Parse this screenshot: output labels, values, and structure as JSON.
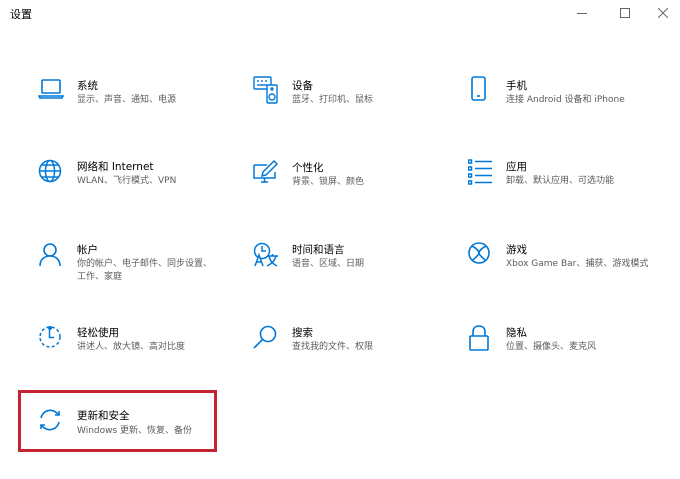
{
  "window": {
    "title": "设置"
  },
  "tiles": [
    {
      "name": "系统",
      "desc": "显示、声音、通知、电源",
      "icon": "laptop-icon"
    },
    {
      "name": "设备",
      "desc": "蓝牙、打印机、鼠标",
      "icon": "keyboard-speaker-icon"
    },
    {
      "name": "手机",
      "desc": "连接 Android 设备和 iPhone",
      "icon": "phone-icon"
    },
    {
      "name": "网络和 Internet",
      "desc": "WLAN、飞行模式、VPN",
      "icon": "globe-icon"
    },
    {
      "name": "个性化",
      "desc": "背景、锁屏、颜色",
      "icon": "paint-monitor-icon"
    },
    {
      "name": "应用",
      "desc": "卸载、默认应用、可选功能",
      "icon": "app-list-icon"
    },
    {
      "name": "帐户",
      "desc": "你的帐户、电子邮件、同步设置、工作、家庭",
      "icon": "person-icon"
    },
    {
      "name": "时间和语言",
      "desc": "语音、区域、日期",
      "icon": "time-language-icon"
    },
    {
      "name": "游戏",
      "desc": "Xbox Game Bar、捕获、游戏模式",
      "icon": "xbox-icon"
    },
    {
      "name": "轻松使用",
      "desc": "讲述人、放大镜、高对比度",
      "icon": "ease-of-access-icon"
    },
    {
      "name": "搜索",
      "desc": "查找我的文件、权限",
      "icon": "search-icon"
    },
    {
      "name": "隐私",
      "desc": "位置、摄像头、麦克风",
      "icon": "lock-icon"
    },
    {
      "name": "更新和安全",
      "desc": "Windows 更新、恢复、备份",
      "icon": "sync-arrows-icon",
      "highlighted": true
    }
  ],
  "colors": {
    "accent": "#0078d7",
    "highlight_border": "#c4232f",
    "desc_text": "#5c5c5c"
  }
}
